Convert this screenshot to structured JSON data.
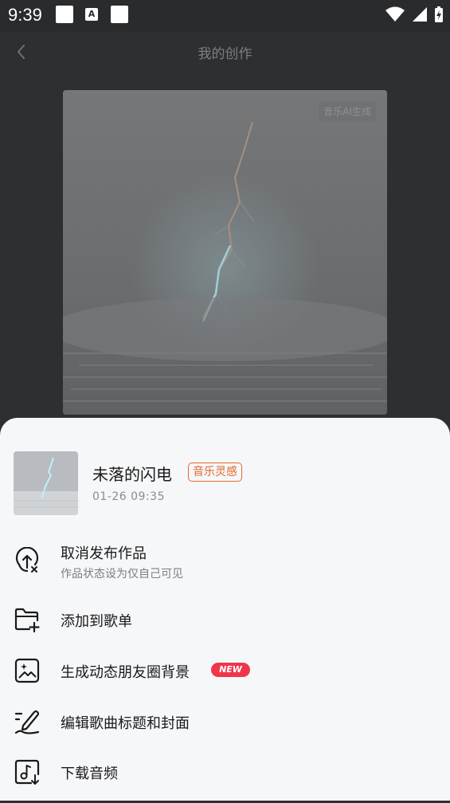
{
  "status_bar": {
    "time": "9:39",
    "a_icon": "A"
  },
  "header": {
    "title": "我的创作"
  },
  "cover": {
    "badge": "音乐AI生成"
  },
  "song": {
    "title": "未落的闪电",
    "tag": "音乐灵感",
    "time": "01-26 09:35"
  },
  "menu": [
    {
      "label": "取消发布作品",
      "sub": "作品状态设为仅自己可见",
      "icon": "cloud-upload-x-icon"
    },
    {
      "label": "添加到歌单",
      "icon": "folder-add-icon"
    },
    {
      "label": "生成动态朋友圈背景",
      "badge": "NEW",
      "icon": "image-sparkle-icon"
    },
    {
      "label": "编辑歌曲标题和封面",
      "icon": "edit-pen-icon"
    },
    {
      "label": "下载音频",
      "icon": "music-download-icon"
    }
  ],
  "colors": {
    "accent_orange": "#e4682c",
    "new_badge": "#f0364a",
    "sheet_bg": "#f6f7f9"
  }
}
